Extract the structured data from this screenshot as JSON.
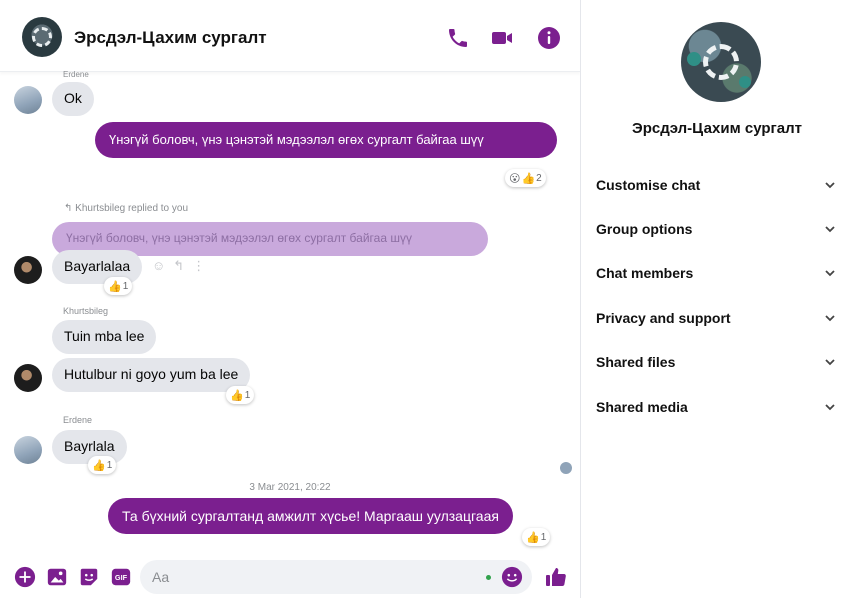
{
  "header": {
    "title": "Эрсдэл-Цахим сургалт",
    "icons": [
      "phone-icon",
      "video-camera-icon",
      "info-icon"
    ]
  },
  "accent_color": "#7b1f8f",
  "messages": {
    "partial_name_top": "Erdene",
    "ok": "Ok",
    "out1": "Үнэгүй боловч, үнэ цэнэтэй мэдээлэл өгөх сургалт байгаа шүү",
    "out1_reaction_count": "2",
    "reply_note": "Khurtsbileg replied to you",
    "reply_quote": "Үнэгүй боловч, үнэ цэнэтэй мэдээлэл өгөх сургалт байгаа шүү",
    "bayarlalaa": "Bayarlalaa",
    "bayarlalaa_reaction_count": "1",
    "name_khurtsbileg": "Khurtsbileg",
    "tuin": "Tuin mba lee",
    "hutulbur": "Hutulbur ni goyo yum ba lee",
    "hutulbur_reaction_count": "1",
    "name_erdene": "Erdene",
    "bayrlala": "Bayrlala",
    "bayrlala_reaction_count": "1",
    "timestamp": "3 Mar 2021, 20:22",
    "out2": "Та бүхний сургалтанд амжилт хүсье! Маргааш уулзацгаая",
    "out2_reaction_count": "1"
  },
  "composer": {
    "placeholder": "Aa",
    "icons": [
      "plus-circle-icon",
      "photo-icon",
      "sticker-icon",
      "gif-icon",
      "emoji-icon",
      "thumbs-up-icon"
    ]
  },
  "sidebar": {
    "title": "Эрсдэл-Цахим сургалт",
    "items": [
      {
        "label": "Customise chat"
      },
      {
        "label": "Group options"
      },
      {
        "label": "Chat members"
      },
      {
        "label": "Privacy and support"
      },
      {
        "label": "Shared files"
      },
      {
        "label": "Shared media"
      }
    ]
  }
}
